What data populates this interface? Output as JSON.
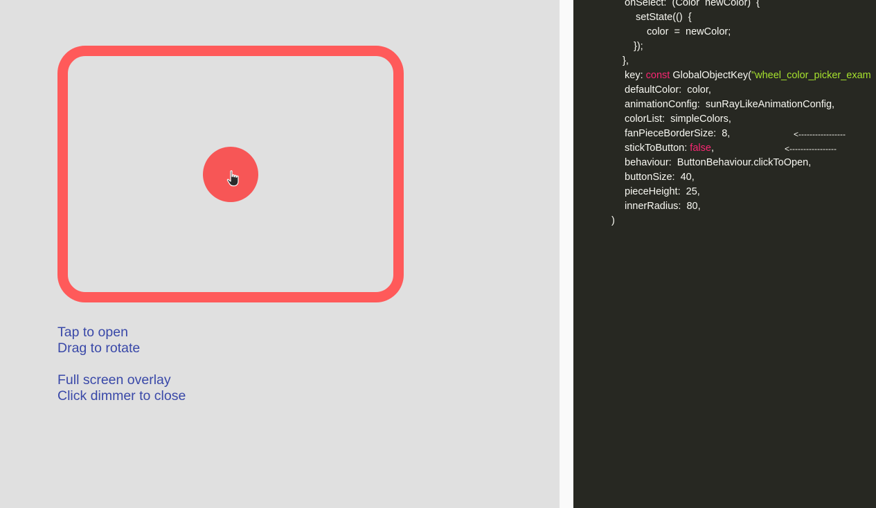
{
  "demo": {
    "button_color": "#f75656",
    "frame_color": "#ff5a5a",
    "cursor_icon": "hand-pointer-icon"
  },
  "instructions": {
    "line1": "Tap to open",
    "line2": "Drag to rotate",
    "line3": "Full screen overlay",
    "line4": "Click dimmer to close"
  },
  "code": {
    "l1": "onSelect:  (Color  newColor)  {",
    "l2": "setState(()  {",
    "l3": "color  =  newColor;",
    "l4": "});",
    "l5": "},",
    "l6_key": "key: ",
    "l6_kw": "const",
    "l6_mid": " GlobalObjectKey(",
    "l6_str": "\"wheel_color_picker_exam",
    "l7": "defaultColor:  color,",
    "l8": "animationConfig:  sunRayLikeAnimationConfig,",
    "l9": "colorList:  simpleColors,",
    "l10": "fanPieceBorderSize:  8,",
    "l10_arrow": "<-----------------",
    "l11_key": "stickToButton: ",
    "l11_kw": "false",
    "l11_end": ",",
    "l11_arrow": "<-----------------",
    "l12": "behaviour:  ButtonBehaviour.clickToOpen,",
    "l13": "buttonSize:  40,",
    "l14": "pieceHeight:  25,",
    "l15": "innerRadius:  80,",
    "l16": ")"
  }
}
